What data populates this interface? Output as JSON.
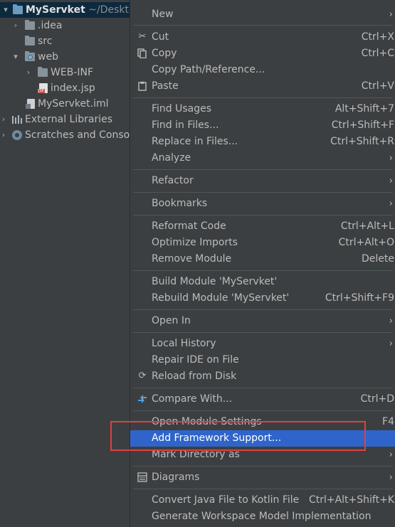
{
  "tree": {
    "root": {
      "name": "MyServket",
      "path": "~/Desktop"
    },
    "items": [
      {
        "label": ".idea"
      },
      {
        "label": "src"
      },
      {
        "label": "web"
      },
      {
        "label": "WEB-INF"
      },
      {
        "label": "index.jsp",
        "badge": "JSP"
      },
      {
        "label": "MyServket.iml"
      },
      {
        "label": "External Libraries"
      },
      {
        "label": "Scratches and Consoles"
      }
    ]
  },
  "menu": {
    "items": [
      {
        "label": "New",
        "shortcut": "",
        "submenu": true,
        "icon": ""
      },
      {
        "label": "Cut",
        "shortcut": "Ctrl+X",
        "submenu": false,
        "icon": "scissors-icon"
      },
      {
        "label": "Copy",
        "shortcut": "Ctrl+C",
        "submenu": false,
        "icon": "copy-icon"
      },
      {
        "label": "Copy Path/Reference...",
        "shortcut": "",
        "submenu": false,
        "icon": ""
      },
      {
        "label": "Paste",
        "shortcut": "Ctrl+V",
        "submenu": false,
        "icon": "paste-icon"
      },
      {
        "label": "Find Usages",
        "shortcut": "Alt+Shift+7",
        "submenu": false,
        "icon": ""
      },
      {
        "label": "Find in Files...",
        "shortcut": "Ctrl+Shift+F",
        "submenu": false,
        "icon": ""
      },
      {
        "label": "Replace in Files...",
        "shortcut": "Ctrl+Shift+R",
        "submenu": false,
        "icon": ""
      },
      {
        "label": "Analyze",
        "shortcut": "",
        "submenu": true,
        "icon": ""
      },
      {
        "label": "Refactor",
        "shortcut": "",
        "submenu": true,
        "icon": ""
      },
      {
        "label": "Bookmarks",
        "shortcut": "",
        "submenu": true,
        "icon": ""
      },
      {
        "label": "Reformat Code",
        "shortcut": "Ctrl+Alt+L",
        "submenu": false,
        "icon": ""
      },
      {
        "label": "Optimize Imports",
        "shortcut": "Ctrl+Alt+O",
        "submenu": false,
        "icon": ""
      },
      {
        "label": "Remove Module",
        "shortcut": "Delete",
        "submenu": false,
        "icon": ""
      },
      {
        "label": "Build Module 'MyServket'",
        "shortcut": "",
        "submenu": false,
        "icon": ""
      },
      {
        "label": "Rebuild Module 'MyServket'",
        "shortcut": "Ctrl+Shift+F9",
        "submenu": false,
        "icon": ""
      },
      {
        "label": "Open In",
        "shortcut": "",
        "submenu": true,
        "icon": ""
      },
      {
        "label": "Local History",
        "shortcut": "",
        "submenu": true,
        "icon": ""
      },
      {
        "label": "Repair IDE on File",
        "shortcut": "",
        "submenu": false,
        "icon": ""
      },
      {
        "label": "Reload from Disk",
        "shortcut": "",
        "submenu": false,
        "icon": "reload-icon"
      },
      {
        "label": "Compare With...",
        "shortcut": "Ctrl+D",
        "submenu": false,
        "icon": "compare-icon"
      },
      {
        "label": "Open Module Settings",
        "shortcut": "F4",
        "submenu": false,
        "icon": ""
      },
      {
        "label": "Add Framework Support...",
        "shortcut": "",
        "submenu": false,
        "icon": "",
        "highlighted": true
      },
      {
        "label": "Mark Directory as",
        "shortcut": "",
        "submenu": true,
        "icon": ""
      },
      {
        "label": "Diagrams",
        "shortcut": "",
        "submenu": true,
        "icon": "diagram-icon"
      },
      {
        "label": "Convert Java File to Kotlin File",
        "shortcut": "Ctrl+Alt+Shift+K",
        "submenu": false,
        "icon": ""
      },
      {
        "label": "Generate Workspace Model Implementation",
        "shortcut": "",
        "submenu": false,
        "icon": ""
      }
    ]
  },
  "colors": {
    "highlight": "#2f65ca",
    "annotation_box": "#e0403f",
    "background": "#3c3f41"
  }
}
